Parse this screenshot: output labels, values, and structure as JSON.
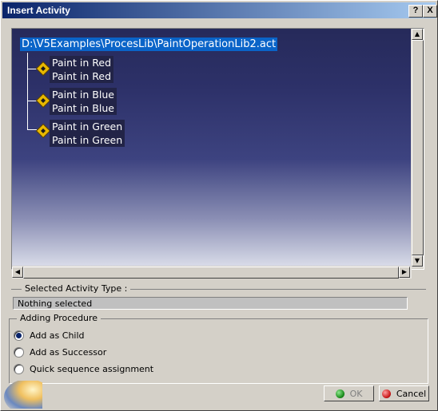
{
  "window": {
    "title": "Insert Activity",
    "help_button": "?",
    "close_button": "X"
  },
  "tree": {
    "root": "D:\\V5Examples\\ProcesLib\\PaintOperationLib2.act",
    "nodes": [
      {
        "name": "Paint in Red",
        "type": "Paint in Red"
      },
      {
        "name": "Paint in Blue",
        "type": "Paint in Blue"
      },
      {
        "name": "Paint in Green",
        "type": "Paint in Green"
      }
    ]
  },
  "selected_activity": {
    "label": "Selected Activity Type :",
    "value": "Nothing selected"
  },
  "adding_procedure": {
    "label": "Adding Procedure",
    "options": [
      {
        "label": "Add as Child",
        "checked": true
      },
      {
        "label": "Add as Successor",
        "checked": false
      },
      {
        "label": "Quick sequence assignment",
        "checked": false
      }
    ]
  },
  "buttons": {
    "ok": "OK",
    "cancel": "Cancel"
  },
  "colors": {
    "title_start": "#0a246a",
    "title_end": "#a6caf0",
    "root_highlight": "#0a64c8",
    "dialog_bg": "#d4d0c8"
  }
}
